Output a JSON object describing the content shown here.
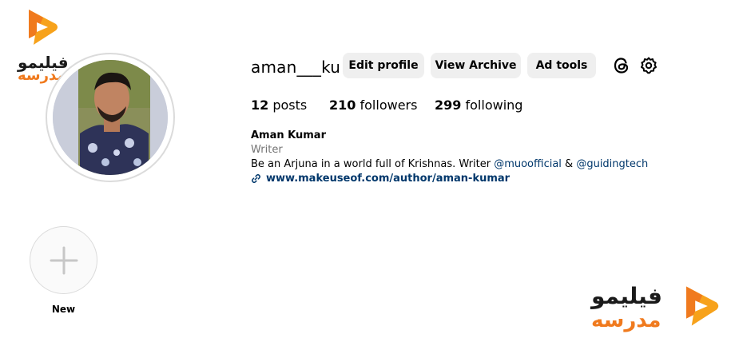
{
  "watermark": {
    "brand_line1": "فیلیمو",
    "brand_line2": "مدرسه"
  },
  "profile": {
    "username": "aman___ku",
    "buttons": {
      "edit": "Edit profile",
      "archive": "View Archive",
      "ad_tools": "Ad tools"
    },
    "stats": {
      "posts_count": "12",
      "posts_label": "posts",
      "followers_count": "210",
      "followers_label": "followers",
      "following_count": "299",
      "following_label": "following"
    },
    "bio": {
      "name": "Aman Kumar",
      "category": "Writer",
      "text_prefix": "Be an Arjuna in a world full of Krishnas. Writer ",
      "mention1": "@muoofficial",
      "text_mid": " & ",
      "mention2": "@guidingtech",
      "link": "www.makeuseof.com/author/aman-kumar"
    }
  },
  "highlights": {
    "new_label": "New"
  },
  "icons": {
    "threads": "threads-icon",
    "settings": "gear-icon",
    "link": "link-icon",
    "plus": "plus-icon"
  },
  "colors": {
    "button_bg": "#efefef",
    "link": "#00376b",
    "muted": "#737373",
    "brand_orange": "#f07a1e"
  }
}
